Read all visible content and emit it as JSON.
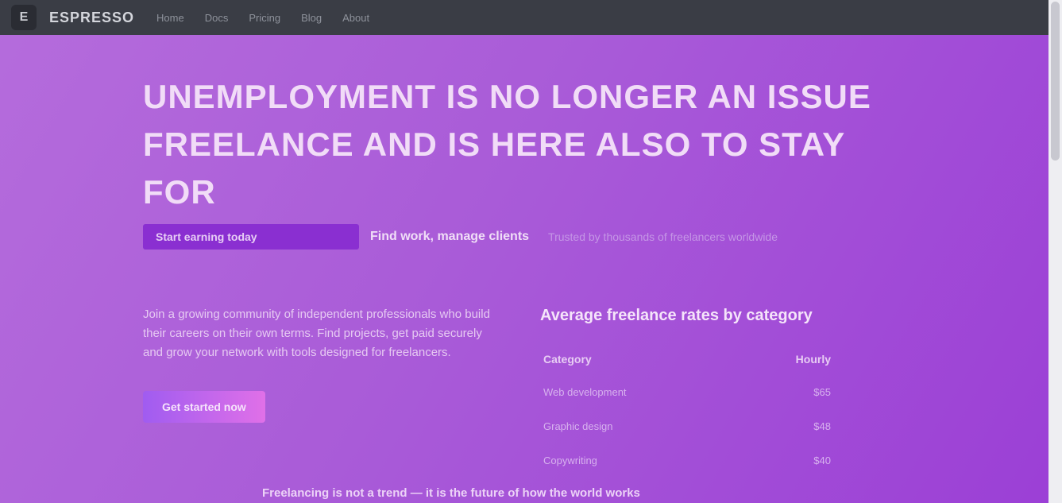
{
  "topbar": {
    "logo": "E",
    "brand": "ESPRESSO",
    "nav": [
      "Home",
      "Docs",
      "Pricing",
      "Blog",
      "About"
    ]
  },
  "hero": {
    "title": "Unemployment is no longer an issue freelance and is here also to stay for",
    "tag": "Start earning today",
    "subtitle": "Find work, manage clients",
    "subtitle_faint": "Trusted by thousands of freelancers worldwide"
  },
  "left": {
    "description": "Join a growing community of independent professionals who build their careers on their own terms. Find projects, get paid securely and grow your network with tools designed for freelancers.",
    "cta": "Get started now"
  },
  "right": {
    "title": "Average freelance rates by category",
    "table": {
      "headers": [
        "Category",
        "Hourly"
      ],
      "rows": [
        [
          "Web development",
          "$65"
        ],
        [
          "Graphic design",
          "$48"
        ],
        [
          "Copywriting",
          "$40"
        ]
      ]
    }
  },
  "footer": {
    "text": "Freelancing is not a trend — it is the future of how the world works"
  },
  "colors": {
    "accent": "#8a2fd1",
    "background": "#a95bd8",
    "topbar": "#3a3d45"
  }
}
